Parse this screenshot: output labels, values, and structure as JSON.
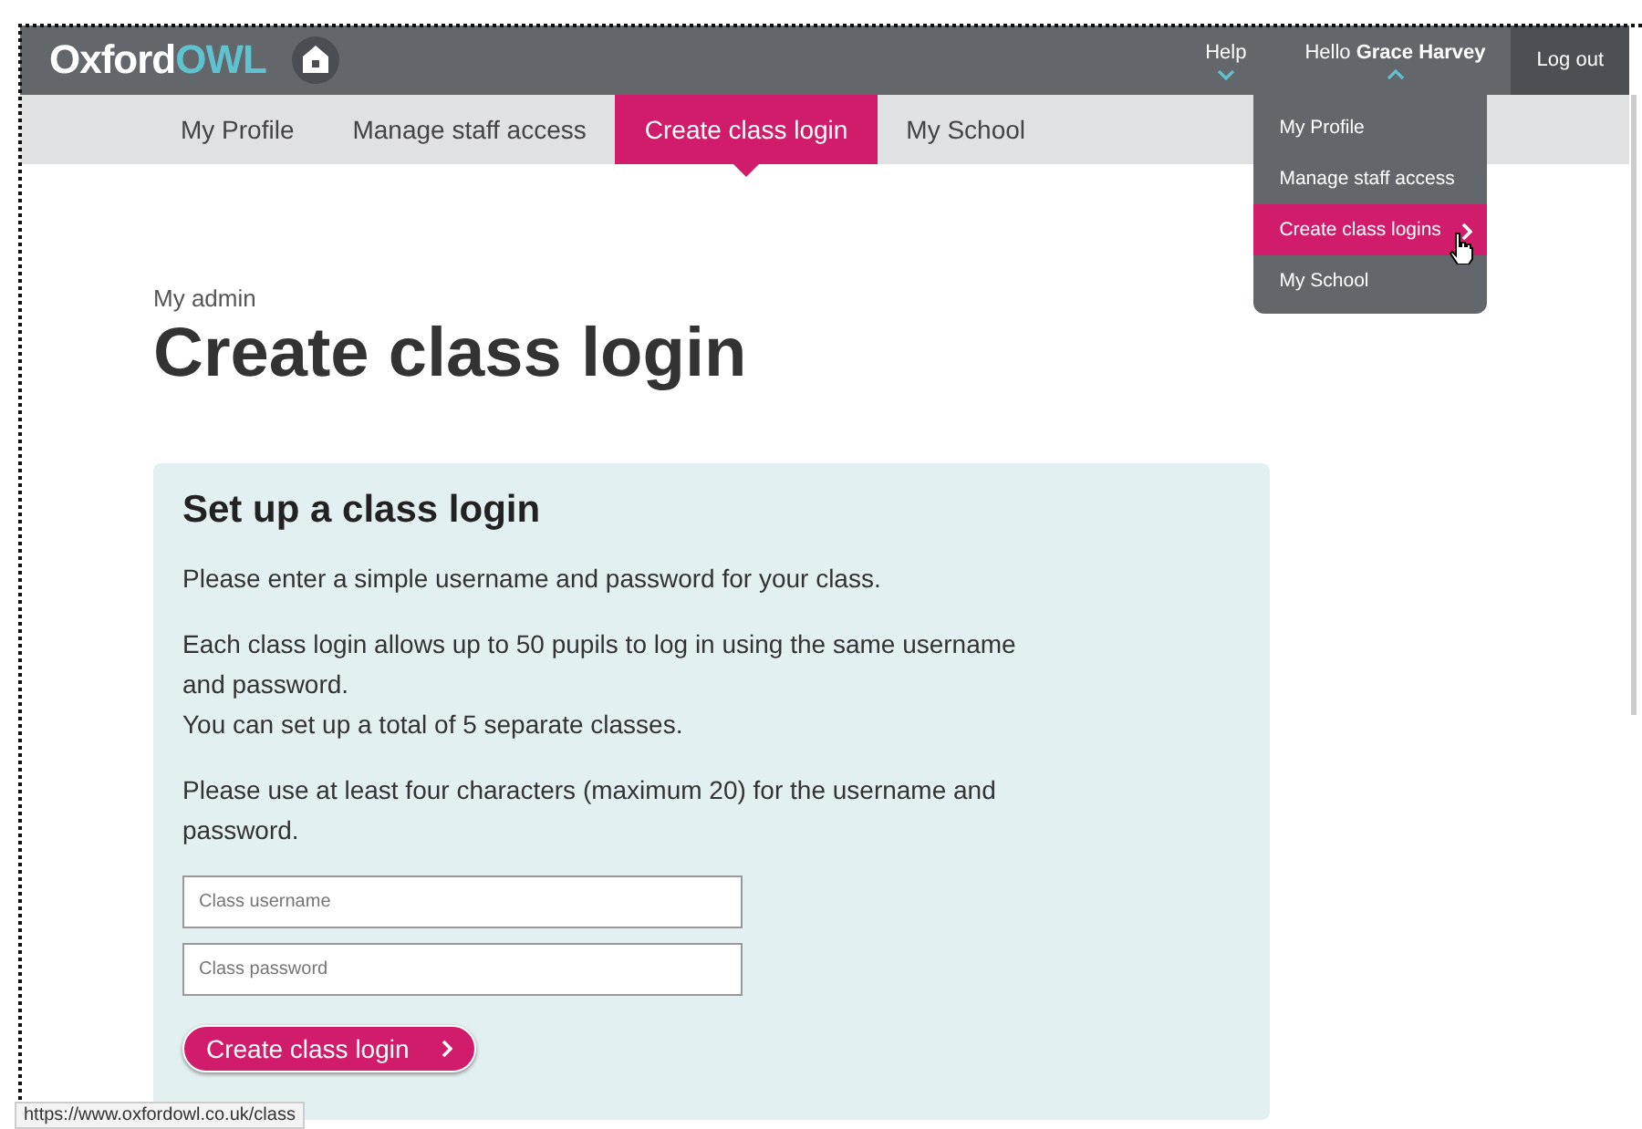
{
  "header": {
    "logo": [
      "Oxford",
      "OWL"
    ],
    "help": "Help",
    "greeting": "Hello **Grace Harvey**",
    "logout": "Log out"
  },
  "nav": [
    {
      "label": "My Profile",
      "selected": false
    },
    {
      "label": "Manage staff access",
      "selected": false
    },
    {
      "label": "Create class login",
      "selected": true
    },
    {
      "label": "My School",
      "selected": false
    }
  ],
  "dropdown": [
    {
      "label": "My Profile",
      "selected": false
    },
    {
      "label": "Manage staff access",
      "selected": false
    },
    {
      "label": "Create class logins",
      "selected": true
    },
    {
      "label": "My School",
      "selected": false
    }
  ],
  "breadcrumb": "My admin",
  "title": "Create class login",
  "panel": {
    "heading": "Set up a class login",
    "paragraphs": [
      "Please enter a simple username and password for your class.",
      "Each class login allows up to 50 pupils to log in using the same username and password.",
      "You can set up a total of 5 separate classes.",
      "Please use at least four characters (maximum 20) for the username and password."
    ],
    "fields": [
      {
        "placeholder": "Class username"
      },
      {
        "placeholder": "Class password"
      }
    ],
    "button": "Create class login"
  },
  "status_url": "https://www.oxfordowl.co.uk/class"
}
